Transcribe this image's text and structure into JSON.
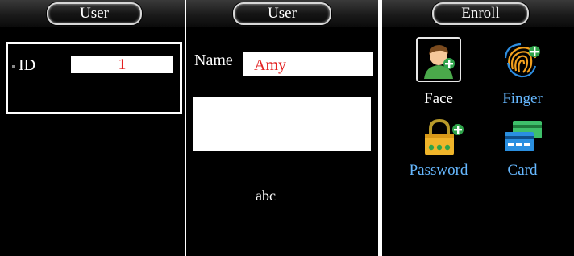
{
  "user_id_panel": {
    "title": "User",
    "id_label": "ID",
    "id_value": "1"
  },
  "user_name_panel": {
    "title": "User",
    "name_label": "Name",
    "name_value": "Amy",
    "input_mode": "abc"
  },
  "enroll_panel": {
    "title": "Enroll",
    "items": [
      {
        "label": "Face",
        "icon": "face-icon",
        "color": "#ffffff",
        "selected": true
      },
      {
        "label": "Finger",
        "icon": "fingerprint-icon",
        "color": "#66b8ff"
      },
      {
        "label": "Password",
        "icon": "password-lock-icon",
        "color": "#66b8ff"
      },
      {
        "label": "Card",
        "icon": "card-icon",
        "color": "#66b8ff"
      }
    ]
  },
  "colors": {
    "background": "#000000",
    "input_text": "#e32020",
    "unselected_caption": "#66b8ff"
  }
}
